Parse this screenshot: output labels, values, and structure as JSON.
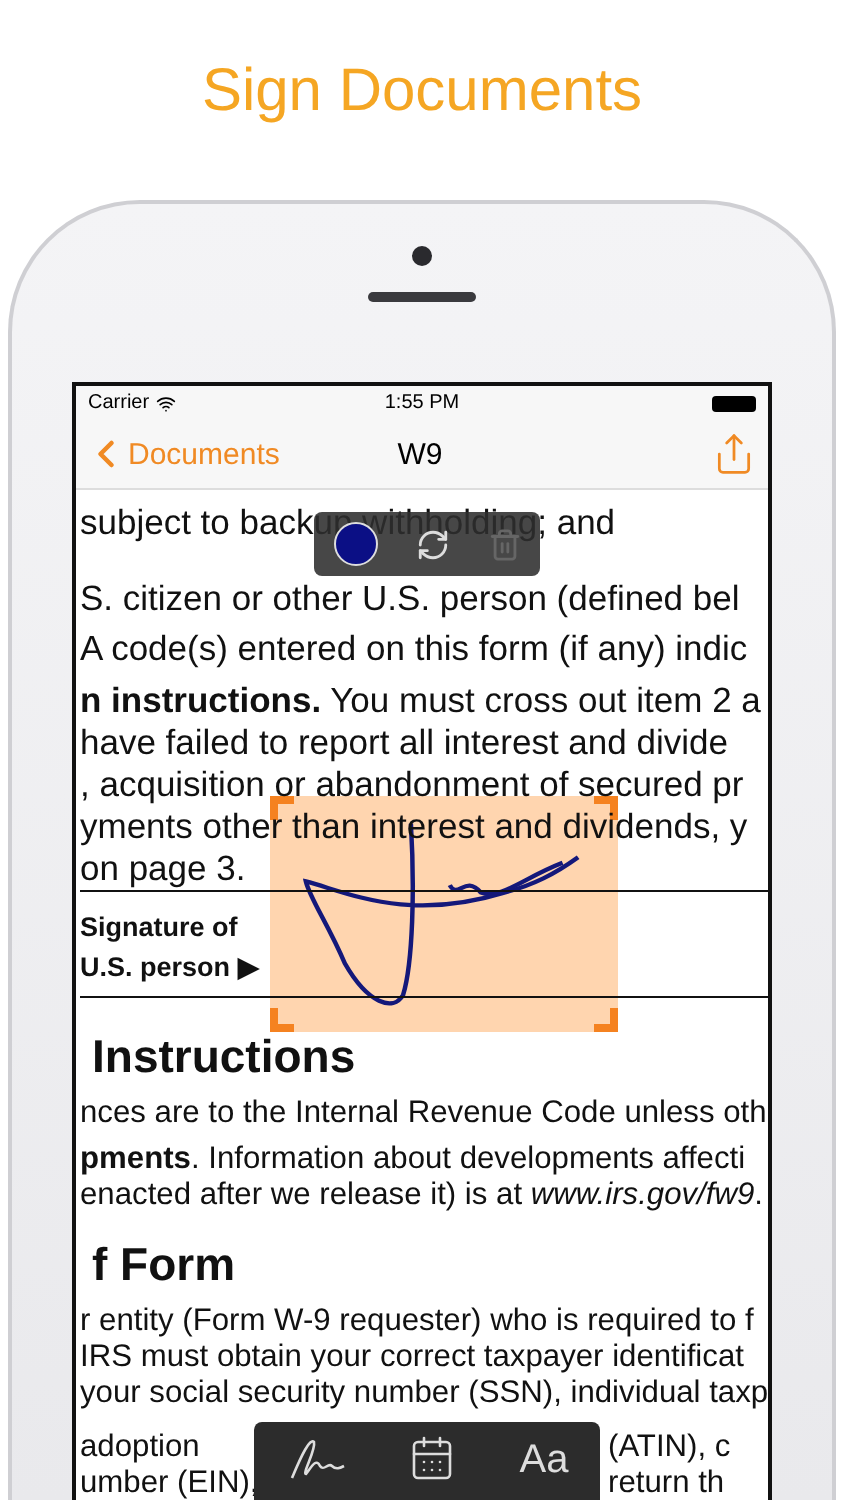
{
  "headline": "Sign Documents",
  "status_bar": {
    "carrier": "Carrier",
    "time": "1:55 PM"
  },
  "nav_bar": {
    "back": "Documents",
    "title": "W9"
  },
  "document": {
    "blocks": [
      {
        "kind": "para_large",
        "lines": [
          "subject to backup withholding; and"
        ]
      },
      {
        "kind": "para_large",
        "lines": [
          "S. citizen or other U.S. person (defined bel"
        ]
      },
      {
        "kind": "para_large",
        "lines": [
          "A code(s) entered on this form (if any) indic"
        ]
      },
      {
        "kind": "para_large",
        "lines": [
          "**n instructions.** You must cross out item 2 a",
          "have failed to report all interest and divide",
          ", acquisition or abandonment of secured pr",
          "yments other than interest and dividends, y",
          "on page 3."
        ]
      },
      {
        "kind": "signature_row",
        "lines": [
          "Signature of",
          "U.S. person ▶"
        ]
      },
      {
        "kind": "heading",
        "lines": [
          "Instructions"
        ]
      },
      {
        "kind": "para_small",
        "lines": [
          "nces are to the Internal Revenue Code unless oth"
        ]
      },
      {
        "kind": "para_small",
        "lines": [
          "**pments**. Information about developments affecti",
          "enacted after we release it) is at *www.irs.gov/fw9*."
        ]
      },
      {
        "kind": "heading",
        "lines": [
          "f Form"
        ]
      },
      {
        "kind": "para_small",
        "lines": [
          "r entity (Form W-9 requester) who is required to f",
          "IRS must obtain your correct taxpayer identificat",
          "your social security number (SSN), individual taxp"
        ]
      },
      {
        "kind": "toolbar_row",
        "left": [
          "adoption",
          "umber (EIN),"
        ],
        "right": [
          "(ATIN), c",
          "return th"
        ]
      }
    ]
  },
  "edit_toolbar": {
    "delete_disabled": true
  },
  "bottom_toolbar": {
    "text_tool_glyph": "Aa"
  }
}
